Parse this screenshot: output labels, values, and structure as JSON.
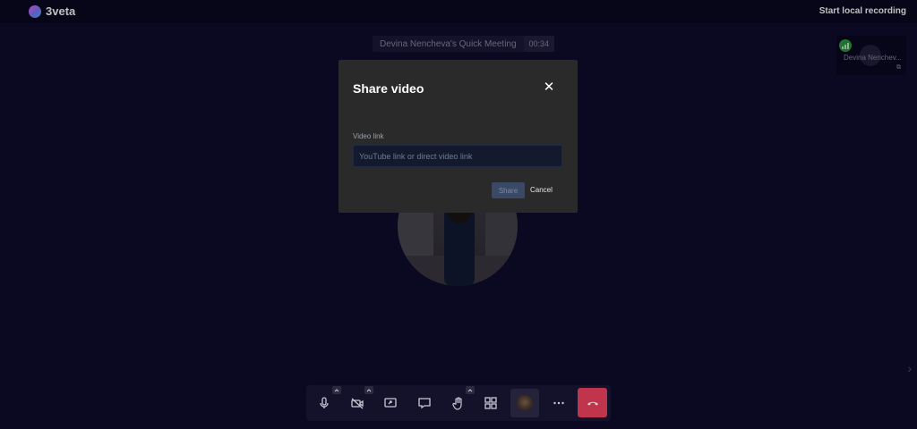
{
  "header": {
    "logo_text": "3veta",
    "record_label": "Start local recording"
  },
  "meeting": {
    "title": "Devina Nencheva's Quick Meeting",
    "timer": "00:34"
  },
  "participant_tile": {
    "name": "Devina Nenchev...",
    "connection_icon": "signal-bars-icon"
  },
  "modal": {
    "title": "Share video",
    "field_label": "Video link",
    "field_value": "",
    "field_placeholder": "YouTube link or direct video link",
    "share_label": "Share",
    "cancel_label": "Cancel"
  },
  "toolbar": {
    "buttons": [
      {
        "icon": "microphone-icon",
        "has_menu": true
      },
      {
        "icon": "camera-off-icon",
        "has_menu": true
      },
      {
        "icon": "screen-share-icon",
        "has_menu": false
      },
      {
        "icon": "chat-icon",
        "has_menu": false
      },
      {
        "icon": "raise-hand-icon",
        "has_menu": true
      },
      {
        "icon": "tile-view-icon",
        "has_menu": false
      },
      {
        "icon": "avatar-icon",
        "has_menu": false
      },
      {
        "icon": "more-icon",
        "has_menu": false
      },
      {
        "icon": "hangup-icon",
        "has_menu": false
      }
    ]
  },
  "colors": {
    "background": "#0f0c2c",
    "modal_bg": "#2a2a2b",
    "hangup": "#c0354b",
    "share_disabled": "#3a4a66"
  }
}
